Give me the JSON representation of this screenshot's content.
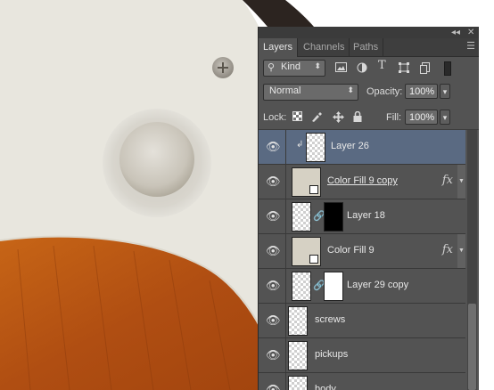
{
  "panel": {
    "collapse_glyph": "◂◂",
    "close_glyph": "✕",
    "tabs": [
      {
        "label": "Layers",
        "active": true
      },
      {
        "label": "Channels",
        "active": false
      },
      {
        "label": "Paths",
        "active": false
      }
    ],
    "menu_glyph": "☰",
    "filter": {
      "search_glyph": "⚲",
      "kind_label": "Kind",
      "arrow": "⬍",
      "icons": [
        "image-filter-icon",
        "adjustment-filter-icon",
        "type-filter-icon",
        "shape-filter-icon",
        "smart-object-filter-icon"
      ],
      "type_glyph": "T"
    },
    "blend": {
      "mode": "Normal",
      "arrow": "⬍"
    },
    "opacity": {
      "label": "Opacity:",
      "value": "100%",
      "arrow": "▾"
    },
    "lock": {
      "label": "Lock:"
    },
    "fill": {
      "label": "Fill:",
      "value": "100%",
      "arrow": "▾"
    },
    "layers": [
      {
        "name": "Layer 26",
        "selected": true,
        "clipped": true,
        "thumb": "transparent",
        "clip_glyph": "↲"
      },
      {
        "name": "Color Fill 9 copy",
        "thumb": "fill",
        "fx": "fx",
        "underline": true
      },
      {
        "name": "Layer 18",
        "thumb": "transparent",
        "mask": "black"
      },
      {
        "name": "Color Fill 9",
        "thumb": "fill",
        "fx": "fx"
      },
      {
        "name": "Layer 29 copy",
        "thumb": "transparent",
        "mask": "white"
      },
      {
        "name": "screws",
        "thumb": "transparent"
      },
      {
        "name": "pickups",
        "thumb": "transparent"
      },
      {
        "name": "body",
        "thumb": "transparent"
      }
    ],
    "eye_glyph": "👁",
    "chain_glyph": "🔗"
  },
  "colors": {
    "panel_bg": "#535353",
    "selected_row": "#5a6a82",
    "pickguard": "#e8e6de",
    "wood": "#b65414",
    "knob": "#cfcbc2"
  }
}
